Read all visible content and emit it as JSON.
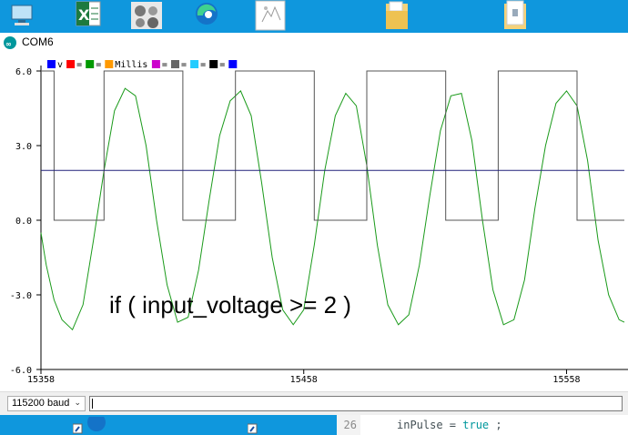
{
  "taskbar": {
    "icons": [
      "computer-icon",
      "excel-icon",
      "photos-icon",
      "edge-icon",
      "image-file-icon",
      "folder-icon",
      "file-icon"
    ]
  },
  "window": {
    "title": "COM6"
  },
  "legend": [
    {
      "label": "v",
      "color": "#0000ff"
    },
    {
      "label": "=",
      "color": "#ff0000"
    },
    {
      "label": "=",
      "color": "#009900"
    },
    {
      "label": "Millis",
      "color": "#ff9900"
    },
    {
      "label": "=",
      "color": "#cc00cc"
    },
    {
      "label": "=",
      "color": "#666666"
    },
    {
      "label": "=",
      "color": "#22ccff"
    },
    {
      "label": "=",
      "color": "#000000"
    },
    {
      "label": "",
      "color": "#0000ff"
    }
  ],
  "annotation": "if ( input_voltage >= 2 )",
  "chart_data": {
    "type": "line",
    "xlim": [
      15358,
      15580
    ],
    "ylim": [
      -6.0,
      6.0
    ],
    "x_ticks": [
      "15358",
      "15458",
      "15558"
    ],
    "y_ticks": [
      "6.0",
      "3.0",
      "0.0",
      "-3.0",
      "-6.0"
    ],
    "grid": false,
    "series": [
      {
        "color": "#1a9a1a",
        "x": [
          15358,
          15360,
          15363,
          15366,
          15370,
          15374,
          15378,
          15382,
          15386,
          15390,
          15394,
          15398,
          15402,
          15406,
          15410,
          15414,
          15418,
          15422,
          15426,
          15430,
          15434,
          15438,
          15442,
          15446,
          15450,
          15454,
          15458,
          15462,
          15466,
          15470,
          15474,
          15478,
          15482,
          15486,
          15490,
          15494,
          15498,
          15502,
          15506,
          15510,
          15514,
          15518,
          15522,
          15526,
          15530,
          15534,
          15538,
          15542,
          15546,
          15550,
          15554,
          15558,
          15562,
          15566,
          15570,
          15574,
          15578,
          15580
        ],
        "y": [
          -0.5,
          -1.8,
          -3.2,
          -4.0,
          -4.4,
          -3.4,
          -0.8,
          2.0,
          4.4,
          5.3,
          5.0,
          3.0,
          0.0,
          -2.6,
          -4.1,
          -3.9,
          -2.0,
          0.8,
          3.4,
          4.8,
          5.2,
          4.2,
          1.5,
          -1.5,
          -3.6,
          -4.2,
          -3.6,
          -1.0,
          2.0,
          4.2,
          5.1,
          4.6,
          2.2,
          -1.0,
          -3.4,
          -4.2,
          -3.8,
          -1.8,
          1.0,
          3.6,
          5.0,
          5.1,
          3.2,
          0.0,
          -2.8,
          -4.2,
          -4.0,
          -2.4,
          0.5,
          3.0,
          4.7,
          5.2,
          4.6,
          2.4,
          -0.8,
          -3.0,
          -4.0,
          -4.1
        ]
      },
      {
        "color": "#555555",
        "x": [
          15358,
          15363,
          15363,
          15382,
          15382,
          15412,
          15412,
          15432,
          15432,
          15462,
          15462,
          15482,
          15482,
          15512,
          15512,
          15532,
          15532,
          15562,
          15562,
          15580
        ],
        "y": [
          6.0,
          6.0,
          0.0,
          0.0,
          6.0,
          6.0,
          0.0,
          0.0,
          6.0,
          6.0,
          0.0,
          0.0,
          6.0,
          6.0,
          0.0,
          0.0,
          6.0,
          6.0,
          0.0,
          0.0
        ]
      },
      {
        "color": "#22227a",
        "x": [
          15358,
          15580
        ],
        "y": [
          2.0,
          2.0
        ]
      }
    ]
  },
  "controls": {
    "baud": "115200 baud",
    "send_value": ""
  },
  "editor": {
    "line_number": "26",
    "code_var": "inPulse = ",
    "code_kw": "true",
    "code_end": " ;"
  }
}
